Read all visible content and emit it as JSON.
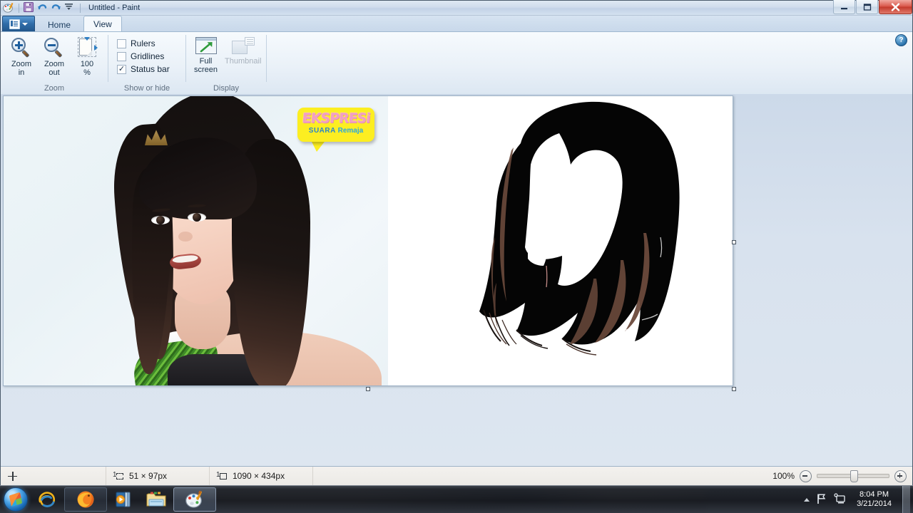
{
  "window": {
    "title": "Untitled - Paint",
    "quick_access": [
      "paint-app-icon",
      "save-icon",
      "undo-icon",
      "redo-icon",
      "customize-qat-icon"
    ],
    "controls": {
      "minimize": "—",
      "maximize": "❐",
      "close": "✕"
    },
    "help_label": "?"
  },
  "ribbon": {
    "app_button": "file-menu-button",
    "tabs": [
      {
        "label": "Home",
        "active": false
      },
      {
        "label": "View",
        "active": true
      }
    ],
    "groups": [
      {
        "name": "Zoom",
        "buttons": [
          {
            "label_line1": "Zoom",
            "label_line2": "in",
            "icon": "zoom-in-icon",
            "disabled": false
          },
          {
            "label_line1": "Zoom",
            "label_line2": "out",
            "icon": "zoom-out-icon",
            "disabled": false
          },
          {
            "label_line1": "100",
            "label_line2": "%",
            "icon": "zoom-100-percent-icon",
            "disabled": false
          }
        ]
      },
      {
        "name": "Show or hide",
        "checkboxes": [
          {
            "label": "Rulers",
            "checked": false,
            "mark": ""
          },
          {
            "label": "Gridlines",
            "checked": false,
            "mark": ""
          },
          {
            "label": "Status bar",
            "checked": true,
            "mark": "✓"
          }
        ]
      },
      {
        "name": "Display",
        "buttons": [
          {
            "label_line1": "Full",
            "label_line2": "screen",
            "icon": "full-screen-icon",
            "disabled": false
          },
          {
            "label_line1": "Thumbnail",
            "label_line2": "",
            "icon": "thumbnail-icon",
            "disabled": true
          }
        ]
      }
    ]
  },
  "canvas": {
    "image_logo": {
      "line1": "EKSPRESi",
      "line2_bold": "SUARA",
      "line2_accent": "Remaja"
    },
    "zoom_percent": "100%"
  },
  "status_bar": {
    "cursor_icon": "cursor-position-icon",
    "selection_icon": "selection-size-icon",
    "selection_size": "51 × 97px",
    "image_icon": "image-size-icon",
    "image_size": "1090 × 434px",
    "zoom_level": "100%",
    "zoom_out_label": "−",
    "zoom_in_label": "+"
  },
  "taskbar": {
    "start_label": "start-orb",
    "items": [
      {
        "name": "internet-explorer",
        "state": "idle"
      },
      {
        "name": "firefox",
        "state": "running"
      },
      {
        "name": "media-player",
        "state": "idle"
      },
      {
        "name": "windows-explorer",
        "state": "idle"
      },
      {
        "name": "paint",
        "state": "active"
      }
    ],
    "tray": {
      "show_hidden_icons": "tray-overflow-arrow",
      "icons": [
        "action-center-flag-icon",
        "network-icon"
      ],
      "time": "8:04 PM",
      "date": "3/21/2014"
    }
  }
}
